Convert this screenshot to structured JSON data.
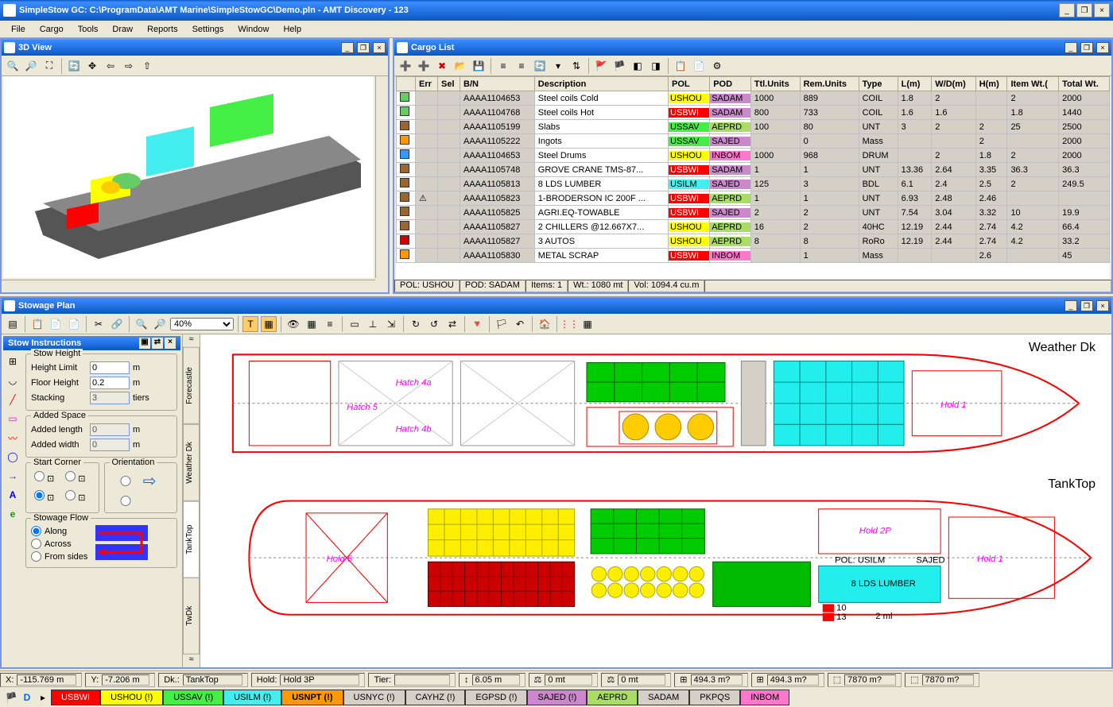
{
  "window_title": "SimpleStow GC: C:\\ProgramData\\AMT Marine\\SimpleStowGC\\Demo.pln - AMT Discovery - 123",
  "menus": [
    "File",
    "Cargo",
    "Tools",
    "Draw",
    "Reports",
    "Settings",
    "Window",
    "Help"
  ],
  "panel_3d": {
    "title": "3D View"
  },
  "panel_cargo": {
    "title": "Cargo List",
    "columns": [
      "",
      "Err",
      "Sel",
      "B/N",
      "Description",
      "POL",
      "POD",
      "Ttl.Units",
      "Rem.Units",
      "Type",
      "L(m)",
      "W/D(m)",
      "H(m)",
      "Item Wt.(",
      "Total Wt."
    ],
    "rows": [
      {
        "icon": "#6c6",
        "bn": "AAAA1104653",
        "desc": "Steel coils Cold",
        "pol": "USHOU",
        "polc": "#ff0",
        "pod": "SADAM",
        "podc": "#c8c",
        "ttl": "1000",
        "rem": "889",
        "type": "COIL",
        "l": "1.8",
        "w": "2",
        "h": "",
        "iw": "2",
        "tw": "2000"
      },
      {
        "icon": "#6c6",
        "bn": "AAAA1104768",
        "desc": "Steel coils Hot",
        "pol": "USBWI",
        "polc": "#f00",
        "pod": "SADAM",
        "podc": "#c8c",
        "ttl": "800",
        "rem": "733",
        "type": "COIL",
        "l": "1.6",
        "w": "1.6",
        "h": "",
        "iw": "1.8",
        "tw": "1440"
      },
      {
        "icon": "#963",
        "bn": "AAAA1105199",
        "desc": "Slabs",
        "pol": "USSAV",
        "polc": "#4e4",
        "pod": "AEPRD",
        "podc": "#ad6",
        "ttl": "100",
        "rem": "80",
        "type": "UNT",
        "l": "3",
        "w": "2",
        "h": "2",
        "iw": "25",
        "tw": "2500"
      },
      {
        "icon": "#f90",
        "bn": "AAAA1105222",
        "desc": "Ingots",
        "pol": "USSAV",
        "polc": "#4e4",
        "pod": "SAJED",
        "podc": "#c8c",
        "ttl": "",
        "rem": "0",
        "type": "Mass",
        "l": "",
        "w": "",
        "h": "2",
        "iw": "",
        "tw": "2000"
      },
      {
        "icon": "#39f",
        "bn": "AAAA1104653",
        "desc": "Steel Drums",
        "pol": "USHOU",
        "polc": "#ff0",
        "pod": "INBOM",
        "podc": "#f7c",
        "ttl": "1000",
        "rem": "968",
        "type": "DRUM",
        "l": "",
        "w": "2",
        "h": "1.8",
        "iw": "2",
        "tw": "2000"
      },
      {
        "icon": "#963",
        "bn": "AAAA1105748",
        "desc": "GROVE CRANE TMS-87...",
        "pol": "USBWI",
        "polc": "#f00",
        "pod": "SADAM",
        "podc": "#c8c",
        "ttl": "1",
        "rem": "1",
        "type": "UNT",
        "l": "13.36",
        "w": "2.64",
        "h": "3.35",
        "iw": "36.3",
        "tw": "36.3"
      },
      {
        "icon": "#963",
        "bn": "AAAA1105813",
        "desc": "8 LDS LUMBER",
        "pol": "USILM",
        "polc": "#4ee",
        "pod": "SAJED",
        "podc": "#c8c",
        "ttl": "125",
        "rem": "3",
        "type": "BDL",
        "l": "6.1",
        "w": "2.4",
        "h": "2.5",
        "iw": "2",
        "tw": "249.5"
      },
      {
        "icon": "#963",
        "err": "⚠",
        "bn": "AAAA1105823",
        "desc": "1-BRODERSON IC 200F ...",
        "pol": "USBWI",
        "polc": "#f00",
        "pod": "AEPRD",
        "podc": "#ad6",
        "ttl": "1",
        "rem": "1",
        "type": "UNT",
        "l": "6.93",
        "w": "2.48",
        "h": "2.46",
        "iw": "",
        "tw": ""
      },
      {
        "icon": "#963",
        "bn": "AAAA1105825",
        "desc": "AGRI.EQ-TOWABLE",
        "pol": "USBWI",
        "polc": "#f00",
        "pod": "SAJED",
        "podc": "#c8c",
        "ttl": "2",
        "rem": "2",
        "type": "UNT",
        "l": "7.54",
        "w": "3.04",
        "h": "3.32",
        "iw": "10",
        "tw": "19.9"
      },
      {
        "icon": "#963",
        "bn": "AAAA1105827",
        "desc": "2 CHILLERS @12.667X7...",
        "pol": "USHOU",
        "polc": "#ff0",
        "pod": "AEPRD",
        "podc": "#ad6",
        "ttl": "16",
        "rem": "2",
        "type": "40HC",
        "l": "12.19",
        "w": "2.44",
        "h": "2.74",
        "iw": "4.2",
        "tw": "66.4"
      },
      {
        "icon": "#c00",
        "bn": "AAAA1105827",
        "desc": "3 AUTOS",
        "pol": "USHOU",
        "polc": "#ff0",
        "pod": "AEPRD",
        "podc": "#ad6",
        "ttl": "8",
        "rem": "8",
        "type": "RoRo",
        "l": "12.19",
        "w": "2.44",
        "h": "2.74",
        "iw": "4.2",
        "tw": "33.2"
      },
      {
        "icon": "#f90",
        "bn": "AAAA1105830",
        "desc": "METAL SCRAP",
        "pol": "USBWI",
        "polc": "#f00",
        "pod": "INBOM",
        "podc": "#f7c",
        "ttl": "",
        "rem": "1",
        "type": "Mass",
        "l": "",
        "w": "",
        "h": "2.6",
        "iw": "",
        "tw": "45"
      }
    ],
    "status": [
      "POL: USHOU",
      "POD: SADAM",
      "Items: 1",
      "Wt.: 1080 mt",
      "Vol: 1094.4 cu.m"
    ]
  },
  "panel_stowage": {
    "title": "Stowage Plan",
    "zoom": "40%",
    "side_title": "Stow Instructions",
    "stow_height": {
      "legend": "Stow Height",
      "height_limit_lbl": "Height Limit",
      "height_limit": "0",
      "floor_height_lbl": "Floor Height",
      "floor_height": "0.2",
      "stacking_lbl": "Stacking",
      "stacking": "3",
      "unit_m": "m",
      "unit_tiers": "tiers"
    },
    "added_space": {
      "legend": "Added Space",
      "length_lbl": "Added length",
      "length": "0",
      "width_lbl": "Added width",
      "width": "0",
      "unit": "m"
    },
    "start_corner": {
      "legend": "Start Corner"
    },
    "orientation": {
      "legend": "Orientation"
    },
    "stowage_flow": {
      "legend": "Stowage Flow",
      "along": "Along",
      "across": "Across",
      "from_sides": "From sides"
    },
    "vtabs": [
      "Forecastle",
      "Weather Dk",
      "TankTop",
      "TwDk"
    ],
    "deck_labels": {
      "weather": "Weather Dk",
      "tanktop": "TankTop"
    }
  },
  "statusbar": {
    "x_lbl": "X:",
    "x": "-115.769 m",
    "y_lbl": "Y:",
    "y": "-7.206 m",
    "dk_lbl": "Dk.:",
    "dk": "TankTop",
    "hold_lbl": "Hold:",
    "hold": "Hold 3P",
    "tier_lbl": "Tier:",
    "tier": "",
    "v1": "6.05 m",
    "v2": "0 mt",
    "v3": "0 mt",
    "v4": "494.3 m?",
    "v5": "494.3 m?",
    "v6": "7870 m?",
    "v7": "7870 m?"
  },
  "ports": [
    {
      "name": "USBWI",
      "bg": "#ff0000",
      "fg": "#fff"
    },
    {
      "name": "USHOU (!)",
      "bg": "#ffff00",
      "fg": "#000"
    },
    {
      "name": "USSAV (!)",
      "bg": "#44ee44",
      "fg": "#000"
    },
    {
      "name": "USILM (!)",
      "bg": "#44eeee",
      "fg": "#000"
    },
    {
      "name": "USNPT (!)",
      "bg": "#ff9900",
      "fg": "#000",
      "bold": true
    },
    {
      "name": "USNYC (!)",
      "bg": "#d4d0c8",
      "fg": "#000"
    },
    {
      "name": "CAYHZ (!)",
      "bg": "#d4d0c8",
      "fg": "#000"
    },
    {
      "name": "EGPSD (!)",
      "bg": "#d4d0c8",
      "fg": "#000"
    },
    {
      "name": "SAJED (!)",
      "bg": "#cc88cc",
      "fg": "#000"
    },
    {
      "name": "AEPRD",
      "bg": "#aadd66",
      "fg": "#000"
    },
    {
      "name": "SADAM",
      "bg": "#d4d0c8",
      "fg": "#000"
    },
    {
      "name": "PKPQS",
      "bg": "#d4d0c8",
      "fg": "#000"
    },
    {
      "name": "INBOM",
      "bg": "#ff77cc",
      "fg": "#000"
    }
  ]
}
